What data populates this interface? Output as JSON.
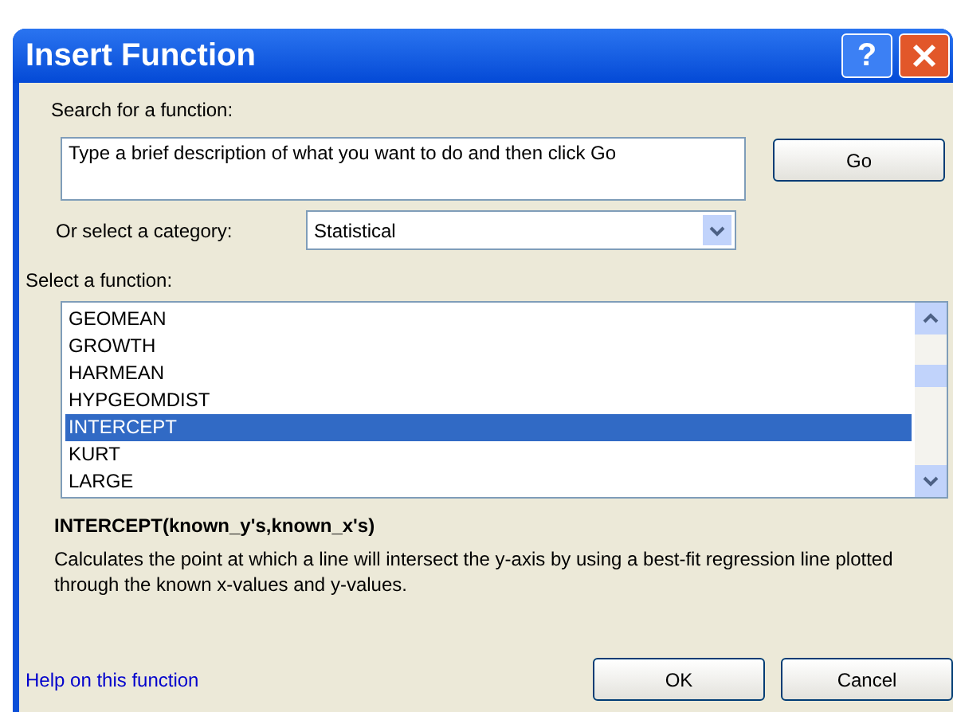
{
  "window": {
    "title": "Insert Function",
    "help_button": "?"
  },
  "search": {
    "label": "Search for a function:",
    "placeholder": "Type a brief description of what you want to do and then click Go",
    "go_button": "Go"
  },
  "category": {
    "label": "Or select a category:",
    "value": "Statistical"
  },
  "functions": {
    "label": "Select a function:",
    "items": [
      {
        "name": "GEOMEAN",
        "selected": false
      },
      {
        "name": "GROWTH",
        "selected": false
      },
      {
        "name": "HARMEAN",
        "selected": false
      },
      {
        "name": "HYPGEOMDIST",
        "selected": false
      },
      {
        "name": "INTERCEPT",
        "selected": true
      },
      {
        "name": "KURT",
        "selected": false
      },
      {
        "name": "LARGE",
        "selected": false
      }
    ]
  },
  "syntax": "INTERCEPT(known_y's,known_x's)",
  "description": "Calculates the point at which a line will intersect the y-axis by using a best-fit regression line plotted through the known x-values and y-values.",
  "help_link": "Help on this function",
  "buttons": [
    "OK",
    "Cancel"
  ]
}
